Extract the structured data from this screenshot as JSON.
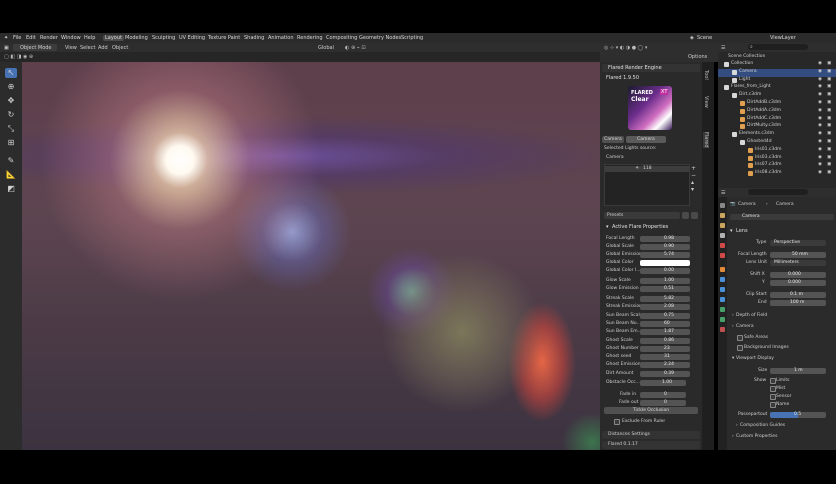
{
  "menu": {
    "file": "File",
    "edit": "Edit",
    "render": "Render",
    "window": "Window",
    "help": "Help"
  },
  "workspaces": [
    "Layout",
    "Modeling",
    "Sculpting",
    "UV Editing",
    "Texture Paint",
    "Shading",
    "Animation",
    "Rendering",
    "Compositing",
    "Geometry Nodes",
    "Scripting"
  ],
  "scene": "Scene",
  "viewlayer": "ViewLayer",
  "header": {
    "mode": "Object Mode",
    "view": "View",
    "select": "Select",
    "add": "Add",
    "object": "Object",
    "orientation": "Global",
    "options": "Options"
  },
  "npanel": {
    "engine_title": "Flared Render Engine",
    "version": "Flared 1.9.50",
    "logo_line1": "FLARED",
    "logo_line2": "Clear",
    "logo_xt": "XT",
    "tab_camera": "Camera",
    "tab_camera2": "Camera",
    "selected_lights": "Selected Lights source:",
    "camera_label": "Camera",
    "list_val": "118",
    "presets": "Presets",
    "active_flare": "Active Flare Properties",
    "props": [
      {
        "label": "Focal Length",
        "value": "0.98"
      },
      {
        "label": "Global Scale",
        "value": "0.90"
      },
      {
        "label": "Global Emission",
        "value": "5.74"
      },
      {
        "label": "Global Color",
        "value": ""
      },
      {
        "label": "Global Color I...",
        "value": "0.00"
      },
      {
        "label": "Glow Scale",
        "value": "1.00"
      },
      {
        "label": "Glow Emission",
        "value": "0.51"
      },
      {
        "label": "Streak Scale",
        "value": "5.82"
      },
      {
        "label": "Streak Emission",
        "value": "2.08"
      },
      {
        "label": "Sun Beam Scale",
        "value": "0.75"
      },
      {
        "label": "Sun Beam Nu...",
        "value": "60"
      },
      {
        "label": "Sun Beam Em...",
        "value": "1.87"
      },
      {
        "label": "Ghost Scale",
        "value": "0.86"
      },
      {
        "label": "Ghost Number",
        "value": "23"
      },
      {
        "label": "Ghost seed",
        "value": "31"
      },
      {
        "label": "Ghost Emission",
        "value": "2.24"
      },
      {
        "label": "Dirt Amount",
        "value": "0.39"
      }
    ],
    "obstacle": {
      "label": "Obstacle Occ...",
      "value": "1.00"
    },
    "fade_in": {
      "label": "Fade in",
      "value": "0"
    },
    "fade_out": {
      "label": "Fade out",
      "value": "0"
    },
    "tickle_btn": "Tickle Occlusion",
    "exclude": "Exclude From Ruler",
    "distances": "Distances Settings",
    "flared_version": "Flared 0.1.17",
    "side_tabs": [
      "Tool",
      "View",
      "Flared"
    ]
  },
  "outliner": {
    "title": "Scene Collection",
    "items": [
      "Collection",
      "Camera",
      "Light",
      "Flares_from_Light",
      "Dirt.c3dm",
      "DirtAddB.c3dm",
      "DirtAddA.c3dm",
      "DirtAddC.c3dm",
      "DirtMulty.c3dm",
      "Elements.c3dm",
      "Ghosted4d",
      "Iris01.c3dm",
      "Iris03.c3dm",
      "Iris07.c3dm",
      "Iris08.c3dm"
    ]
  },
  "props": {
    "breadcrumb_a": "Camera",
    "breadcrumb_b": "Camera",
    "data_name": "Camera",
    "lens": "Lens",
    "type_label": "Type",
    "type_val": "Perspective",
    "focal_label": "Focal Length",
    "focal_val": "50 mm",
    "lensunit_label": "Lens Unit",
    "lensunit_val": "Millimeters",
    "shiftx_label": "Shift X",
    "shiftx_val": "0.000",
    "shifty_label": "Y",
    "shifty_val": "0.000",
    "clipstart_label": "Clip Start",
    "clipstart_val": "0.1 m",
    "end_label": "End",
    "end_val": "100 m",
    "dof": "Depth of Field",
    "camera": "Camera",
    "safe_areas": "Safe Areas",
    "bg_images": "Background Images",
    "viewport_display": "Viewport Display",
    "size_label": "Size",
    "size_val": "1 m",
    "show_label": "Show",
    "limits": "Limits",
    "mist": "Mist",
    "sensor": "Sensor",
    "name": "Name",
    "passepartout": "Passepartout",
    "pp_val": "0.5",
    "composition": "Composition Guides",
    "custom_props": "Custom Properties"
  },
  "colors": {
    "accent": "#4772b3",
    "panel": "#2a2a2a"
  }
}
